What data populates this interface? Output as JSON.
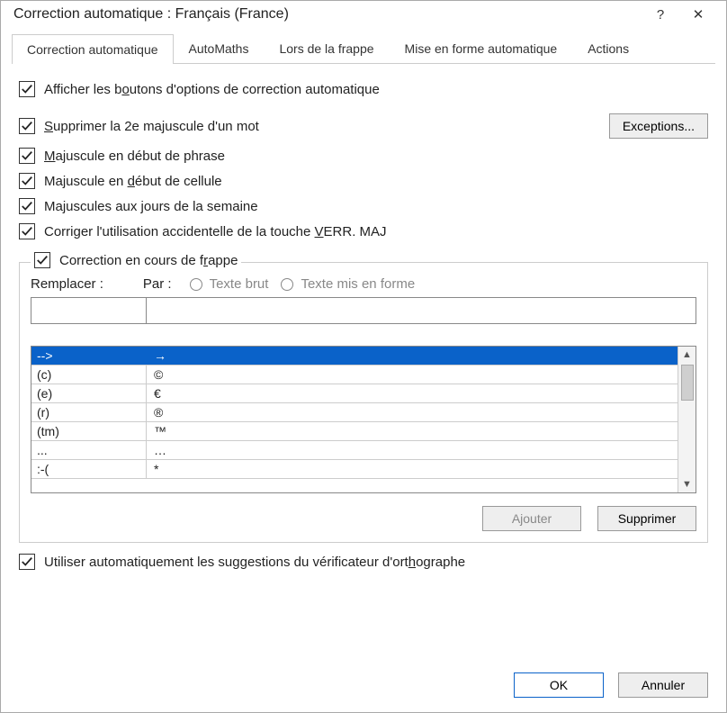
{
  "window": {
    "title": "Correction automatique : Français (France)"
  },
  "tabs": {
    "t0": "Correction automatique",
    "t1": "AutoMaths",
    "t2": "Lors de la frappe",
    "t3": "Mise en forme automatique",
    "t4": "Actions"
  },
  "checkboxes": {
    "show_buttons": "Afficher les boutons d'options de correction automatique",
    "double_cap": "Supprimer la 2e majuscule d'un mot",
    "sentence_cap": "Majuscule en début de phrase",
    "cell_cap": "Majuscule en début de cellule",
    "days_cap": "Majuscules aux jours de la semaine",
    "caps_lock": "Corriger l'utilisation accidentelle de la touche VERR. MAJ",
    "replace_typing": "Correction en cours de frappe",
    "use_spellcheck": "Utiliser automatiquement les suggestions du vérificateur d'orthographe"
  },
  "buttons": {
    "exceptions": "Exceptions...",
    "add": "Ajouter",
    "delete": "Supprimer",
    "ok": "OK",
    "cancel": "Annuler"
  },
  "labels": {
    "replace": "Remplacer :",
    "with": "Par :",
    "plain": "Texte brut",
    "formatted": "Texte mis en forme"
  },
  "list": [
    {
      "from": "-->",
      "to": "→"
    },
    {
      "from": "(c)",
      "to": "©"
    },
    {
      "from": "(e)",
      "to": "€"
    },
    {
      "from": "(r)",
      "to": "®"
    },
    {
      "from": "(tm)",
      "to": "™"
    },
    {
      "from": "...",
      "to": "…"
    },
    {
      "from": ":-(",
      "to": "*"
    }
  ]
}
